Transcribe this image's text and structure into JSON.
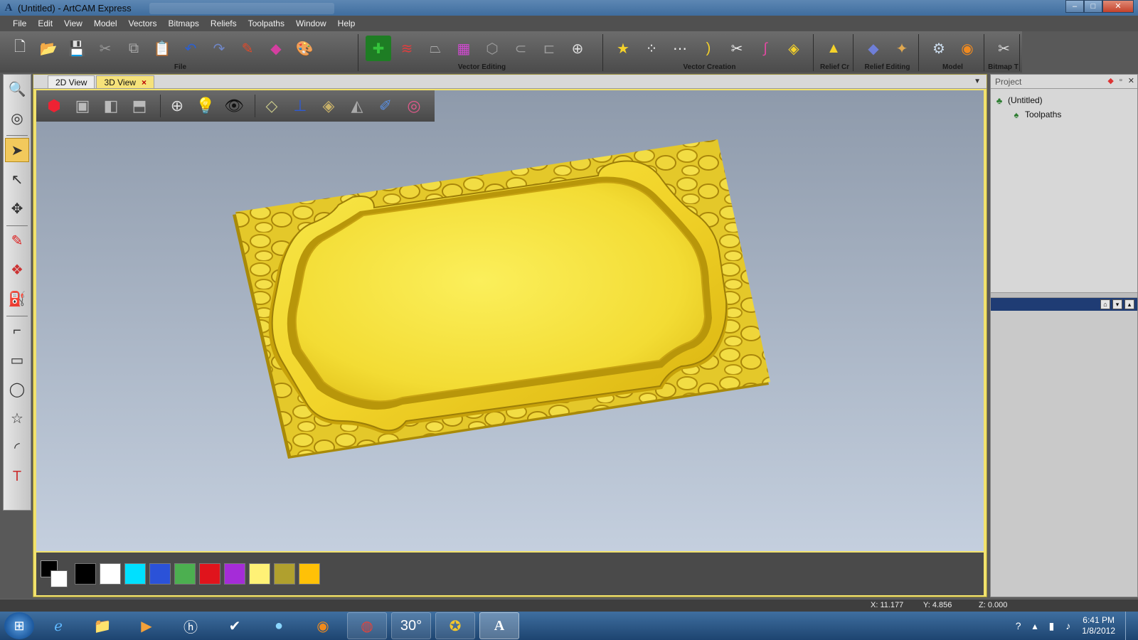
{
  "window": {
    "title": "(Untitled) - ArtCAM Express",
    "app_icon": "A",
    "minimize": "–",
    "maximize": "□",
    "close": "✕"
  },
  "menu": [
    "File",
    "Edit",
    "View",
    "Model",
    "Vectors",
    "Bitmaps",
    "Reliefs",
    "Toolpaths",
    "Window",
    "Help"
  ],
  "toolbar": {
    "groups": [
      {
        "label": "File",
        "icons": [
          "new-file-icon",
          "open-folder-icon",
          "save-icon",
          "cut-icon",
          "copy-icon",
          "paste-icon",
          "undo-icon",
          "redo-icon",
          "edit-icon",
          "eraser-icon",
          "palette-icon"
        ]
      },
      {
        "label": "Vector Editing",
        "icons": [
          "add-node-icon",
          "smooth-vector-icon",
          "mirror-icon",
          "group-icon",
          "offset-icon",
          "join-icon",
          "trim-icon",
          "transform-icon"
        ]
      },
      {
        "label": "Vector Creation",
        "icons": [
          "star-vector-icon",
          "dot-grid-icon",
          "polyline-icon",
          "arc-icon",
          "scissors-icon",
          "bezier-icon",
          "fill-vector-icon"
        ]
      },
      {
        "label": "Relief Cr",
        "icons": [
          "relief-create-icon"
        ]
      },
      {
        "label": "Relief Editing",
        "icons": [
          "relief-plane-icon",
          "relief-edit-icon"
        ]
      },
      {
        "label": "Model",
        "icons": [
          "model-settings-icon",
          "model-render-icon"
        ]
      },
      {
        "label": "Bitmap T",
        "icons": [
          "bitmap-tools-icon"
        ]
      }
    ]
  },
  "tabs": [
    {
      "label": "2D View",
      "active": false
    },
    {
      "label": "3D View",
      "active": true,
      "close": "×"
    }
  ],
  "view_tools": [
    "iso-view-icon",
    "front-view-icon",
    "side-view-icon",
    "top-view-icon",
    "zoom-icon",
    "light-icon",
    "eye-icon",
    "plane-icon",
    "axes-icon",
    "relief-layer-icon",
    "shading-icon",
    "paint-icon",
    "texture-icon"
  ],
  "left_tools": [
    "zoom-box-icon",
    "globe-icon",
    "select-arrow-icon",
    "node-edit-icon",
    "transform-icon",
    "pencil-icon",
    "shape-edit-icon",
    "paint-bucket-icon",
    "polyline-tool-icon",
    "rectangle-icon",
    "ellipse-icon",
    "star-icon",
    "arc-tool-icon",
    "text-tool-icon"
  ],
  "palette": {
    "current_fg": "#000000",
    "current_bg": "#ffffff",
    "swatches": [
      "#000000",
      "#ffffff",
      "#00e0ff",
      "#2b52d8",
      "#4caf50",
      "#e0141c",
      "#a52cd8",
      "#fff176",
      "#b0a02e",
      "#ffc107"
    ]
  },
  "project": {
    "header": "Project",
    "tree": [
      {
        "label": "(Untitled)",
        "icon": "project-root-icon"
      },
      {
        "label": "Toolpaths",
        "icon": "toolpaths-icon"
      }
    ]
  },
  "status": {
    "x": "X: 11.177",
    "y": "Y: 4.856",
    "z": "Z: 0.000"
  },
  "taskbar": {
    "items": [
      "ie-icon",
      "explorer-icon",
      "media-player-icon",
      "hp-icon",
      "tasks-icon",
      "globe-app-icon",
      "firefox-icon",
      "chrome-icon",
      "weather-icon",
      "compass-icon",
      "artcam-icon"
    ],
    "weather_label": "30°",
    "time": "6:41 PM",
    "date": "1/8/2012"
  }
}
